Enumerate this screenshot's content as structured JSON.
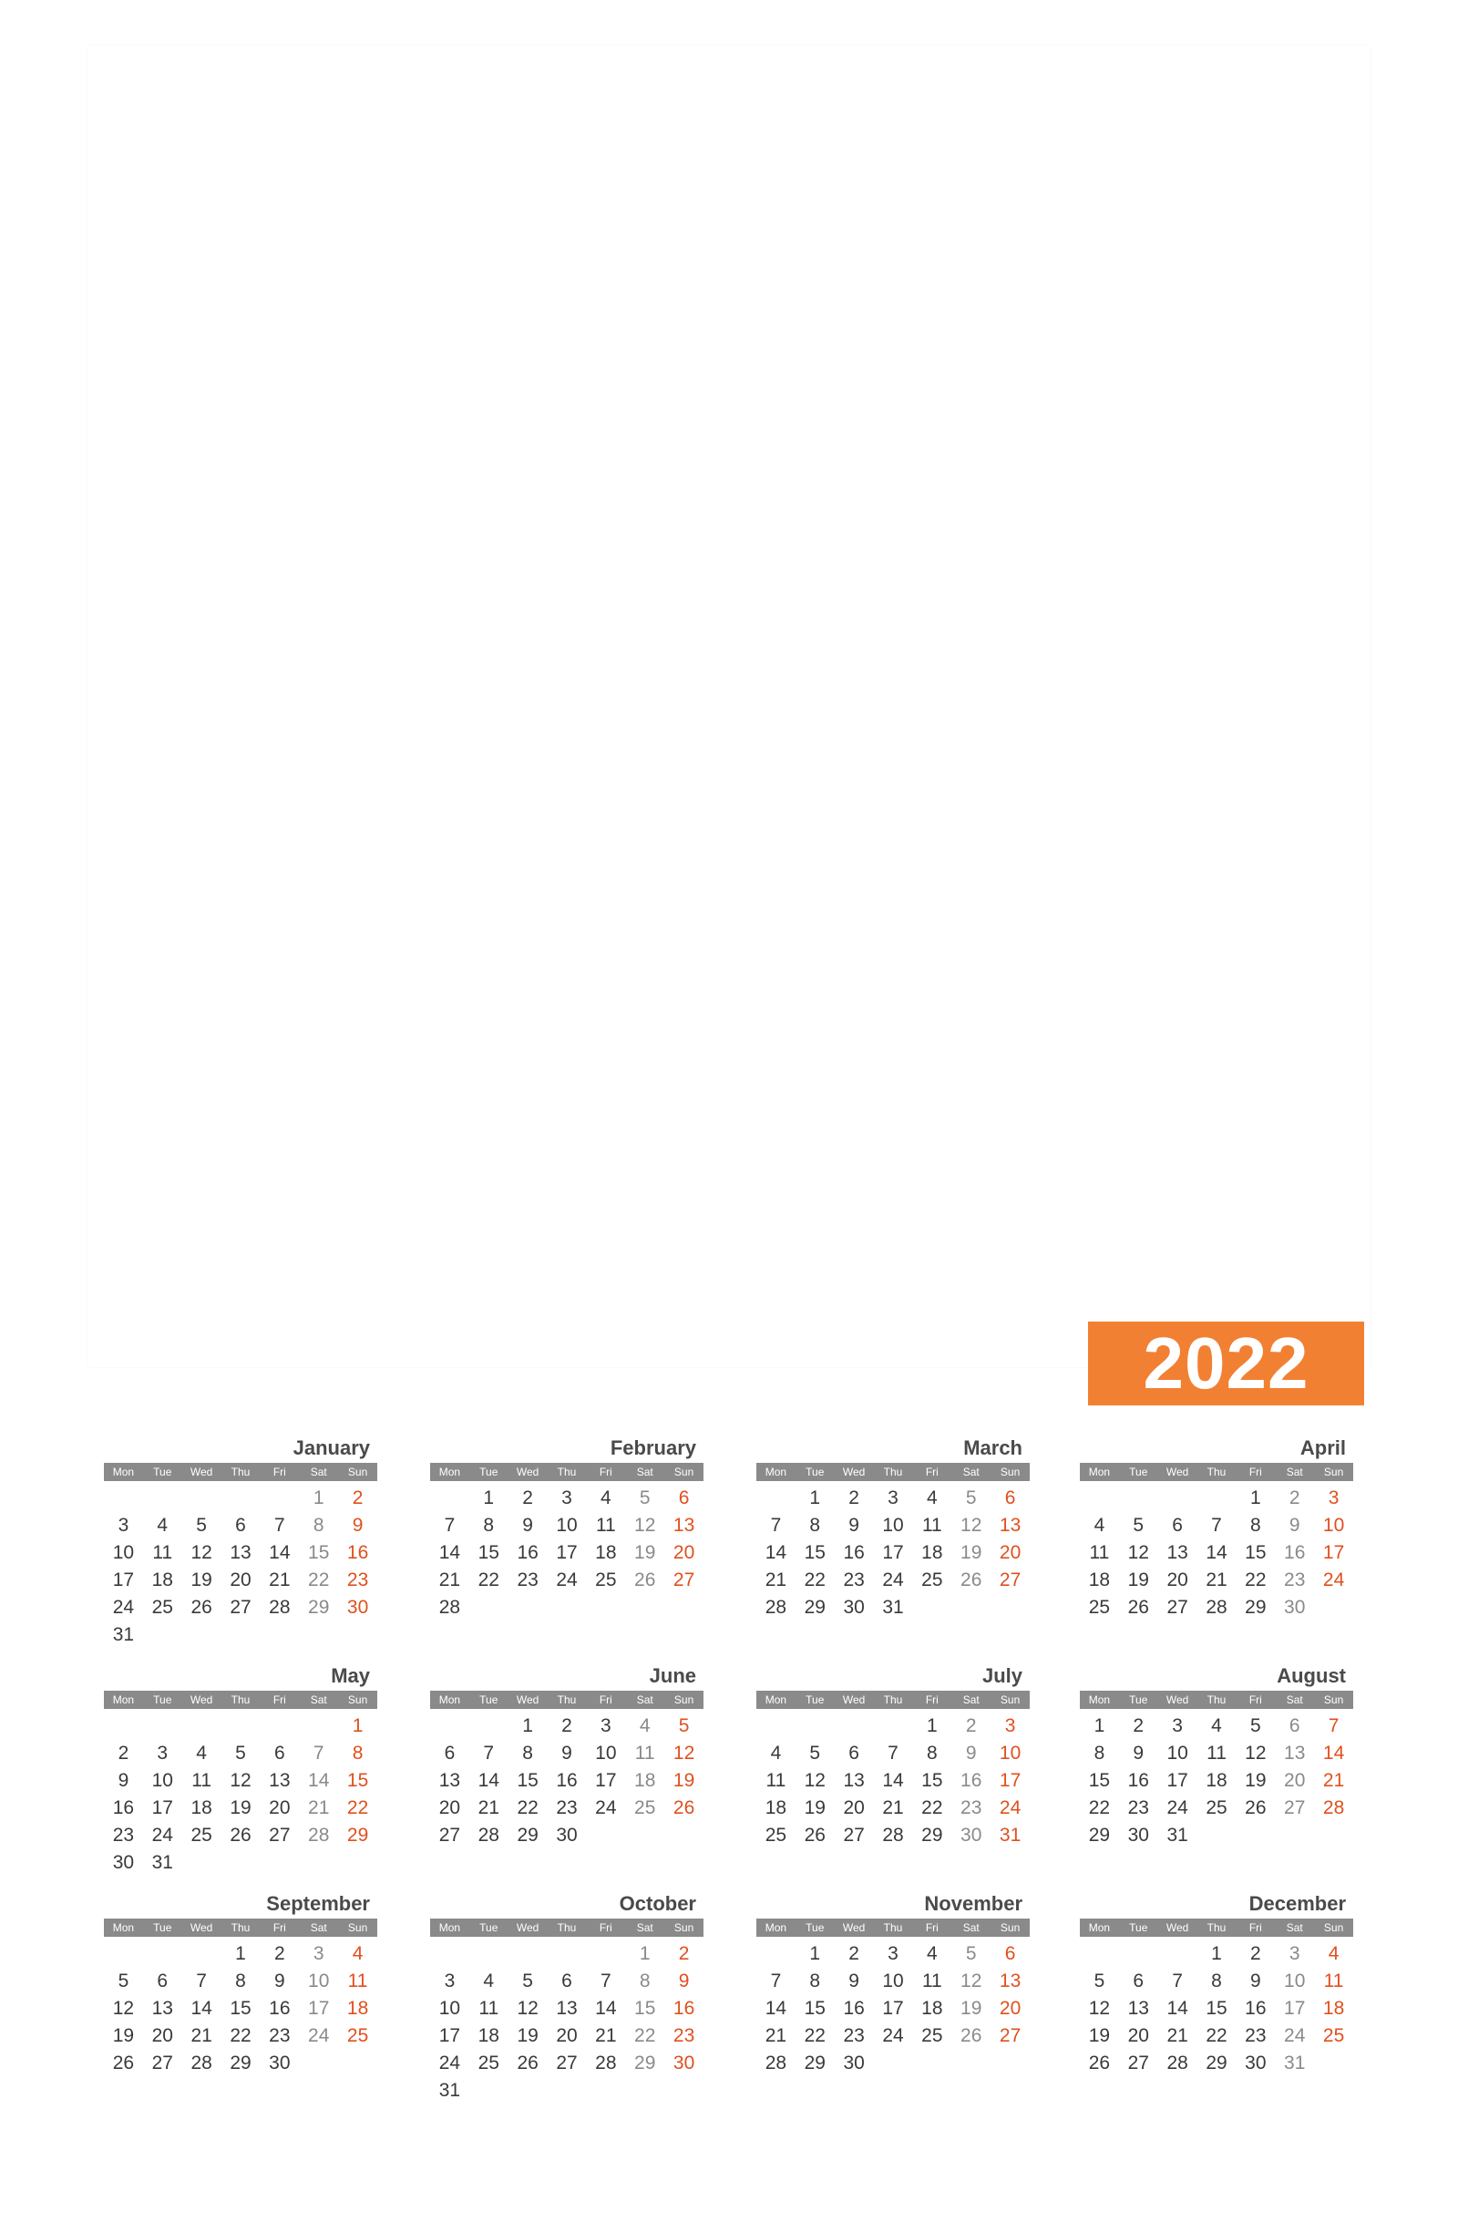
{
  "year": "2022",
  "colors": {
    "accent": "#f28033",
    "sunday": "#e0501e",
    "saturday": "#8a8a8a",
    "header": "#8a8a8a"
  },
  "weekday_labels": [
    "Mon",
    "Tue",
    "Wed",
    "Thu",
    "Fri",
    "Sat",
    "Sun"
  ],
  "months": [
    {
      "name": "January",
      "first_weekday": 6,
      "days": 31
    },
    {
      "name": "February",
      "first_weekday": 2,
      "days": 28
    },
    {
      "name": "March",
      "first_weekday": 2,
      "days": 31
    },
    {
      "name": "April",
      "first_weekday": 5,
      "days": 30
    },
    {
      "name": "May",
      "first_weekday": 7,
      "days": 31
    },
    {
      "name": "June",
      "first_weekday": 3,
      "days": 30
    },
    {
      "name": "July",
      "first_weekday": 5,
      "days": 31
    },
    {
      "name": "August",
      "first_weekday": 1,
      "days": 31
    },
    {
      "name": "September",
      "first_weekday": 4,
      "days": 30
    },
    {
      "name": "October",
      "first_weekday": 6,
      "days": 31
    },
    {
      "name": "November",
      "first_weekday": 2,
      "days": 30
    },
    {
      "name": "December",
      "first_weekday": 4,
      "days": 31
    }
  ]
}
